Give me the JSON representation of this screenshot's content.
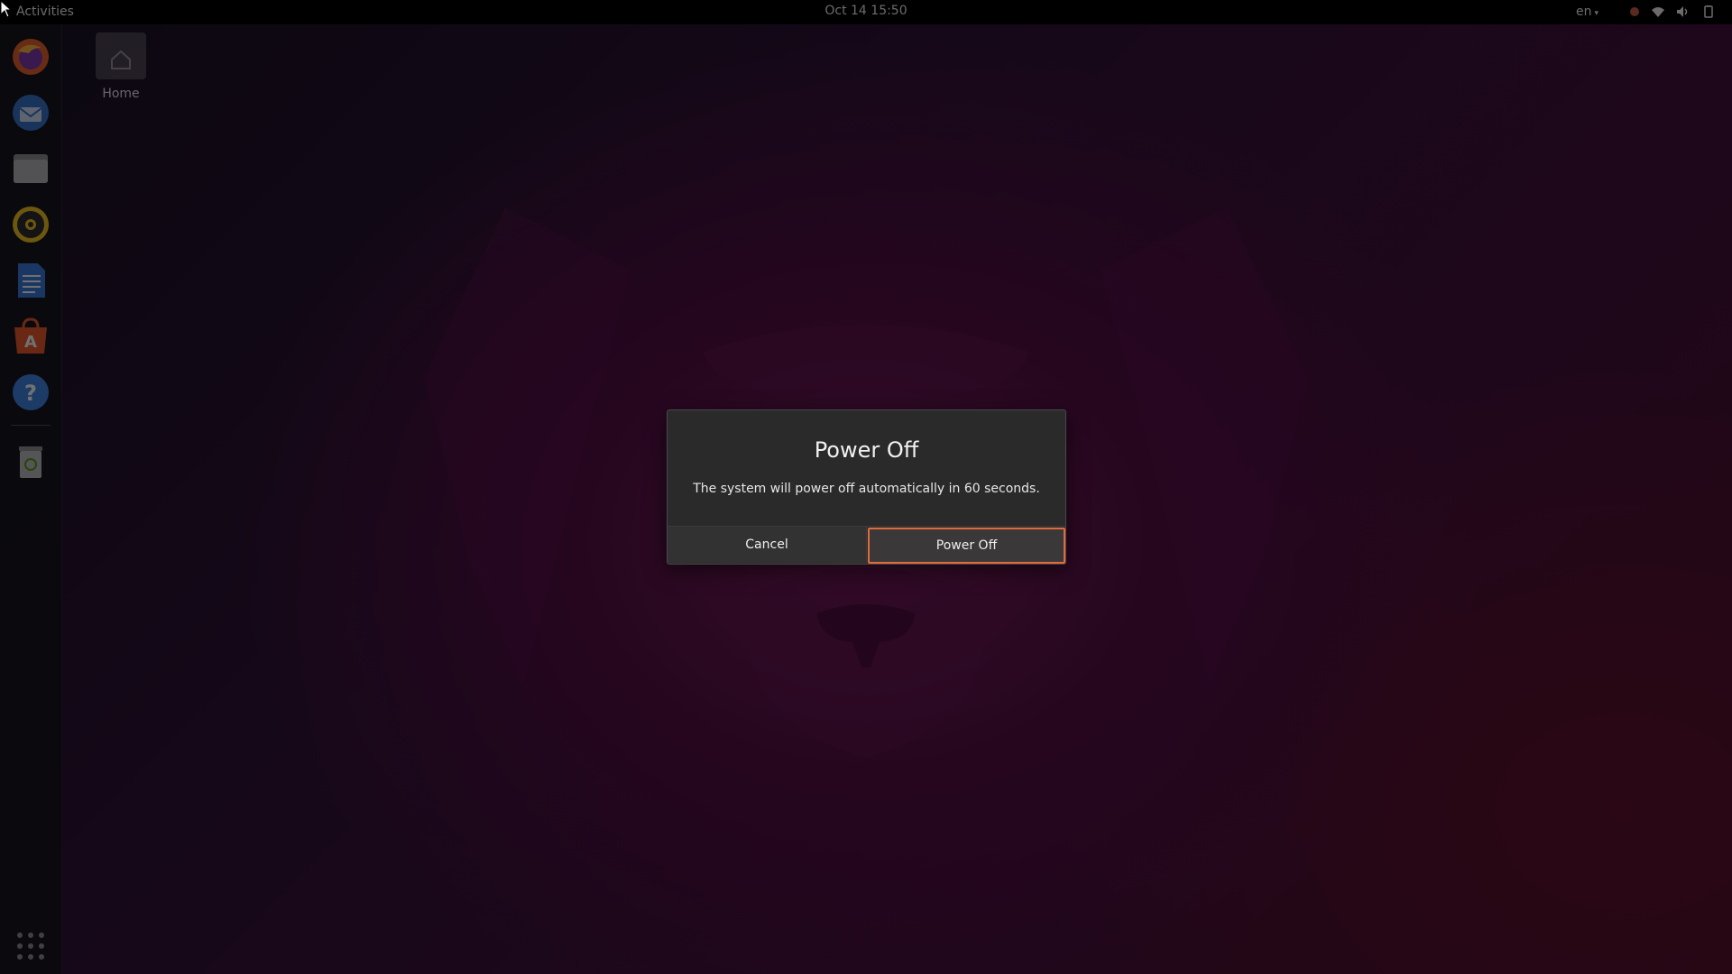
{
  "topbar": {
    "activities_label": "Activities",
    "clock": "Oct 14  15:50",
    "language": "en",
    "tray_icons": [
      "record-indicator-icon",
      "wifi-icon",
      "volume-icon",
      "battery-icon"
    ]
  },
  "dock": {
    "apps": [
      {
        "name": "Firefox",
        "icon": "firefox-icon"
      },
      {
        "name": "Thunderbird",
        "icon": "thunderbird-icon"
      },
      {
        "name": "Files",
        "icon": "files-icon"
      },
      {
        "name": "Rhythmbox",
        "icon": "rhythmbox-icon"
      },
      {
        "name": "LibreOffice Writer",
        "icon": "writer-icon"
      },
      {
        "name": "Ubuntu Software",
        "icon": "software-icon"
      },
      {
        "name": "Help",
        "icon": "help-icon"
      },
      {
        "name": "Trash",
        "icon": "trash-icon"
      }
    ],
    "show_apps_icon": "app-grid-icon"
  },
  "desktop": {
    "home_label": "Home"
  },
  "dialog": {
    "title": "Power Off",
    "message": "The system will power off automatically in 60 seconds.",
    "cancel_label": "Cancel",
    "confirm_label": "Power Off"
  },
  "colors": {
    "accent": "#e36a3d",
    "dialog_bg": "#2b2a2b",
    "topbar_bg": "#000000"
  }
}
